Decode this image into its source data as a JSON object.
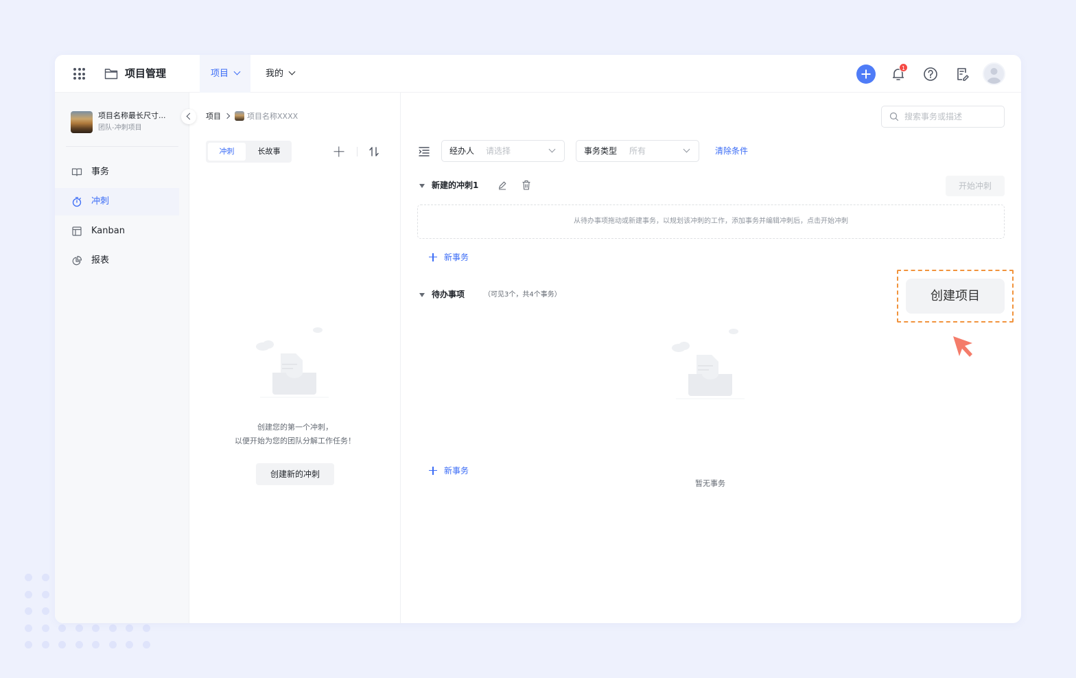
{
  "app": {
    "title": "项目管理"
  },
  "topnav": {
    "tabs": [
      {
        "label": "项目",
        "active": true
      },
      {
        "label": "我的",
        "active": false
      }
    ],
    "notification_count": "1"
  },
  "sidebar": {
    "project_name": "项目名称最长尺寸...",
    "project_type": "团队-冲刺项目",
    "items": [
      {
        "label": "事务",
        "icon": "book-icon",
        "active": false
      },
      {
        "label": "冲刺",
        "icon": "timer-icon",
        "active": true
      },
      {
        "label": "Kanban",
        "icon": "board-icon",
        "active": false
      },
      {
        "label": "报表",
        "icon": "pie-chart-icon",
        "active": false
      }
    ]
  },
  "breadcrumb": {
    "root": "项目",
    "project": "项目名称XXXX"
  },
  "sprint_panel": {
    "tabs": [
      "冲刺",
      "长故事"
    ],
    "empty_line1": "创建您的第一个冲刺，",
    "empty_line2": "以便开始为您的团队分解工作任务！",
    "create_button": "创建新的冲刺"
  },
  "search": {
    "placeholder": "搜索事务或描述"
  },
  "filters": {
    "assignee_label": "经办人",
    "assignee_value": "请选择",
    "type_label": "事务类型",
    "type_value": "所有",
    "clear": "清除条件"
  },
  "sprint": {
    "title": "新建的冲刺1",
    "start_button": "开始冲刺",
    "drop_hint": "从待办事项拖动或新建事务，以规划该冲刺的工作，添加事务并编辑冲刺后，点击开始冲刺",
    "new_issue": "新事务"
  },
  "backlog": {
    "title": "待办事项",
    "count": "（可见3个，共4个事务）",
    "empty": "暂无事务",
    "new_issue": "新事务"
  },
  "callout": {
    "create_project": "创建项目"
  },
  "colors": {
    "accent": "#3b6cf6",
    "highlight": "#f1933c",
    "cursor": "#f47c6a",
    "badge": "#f54a45"
  }
}
